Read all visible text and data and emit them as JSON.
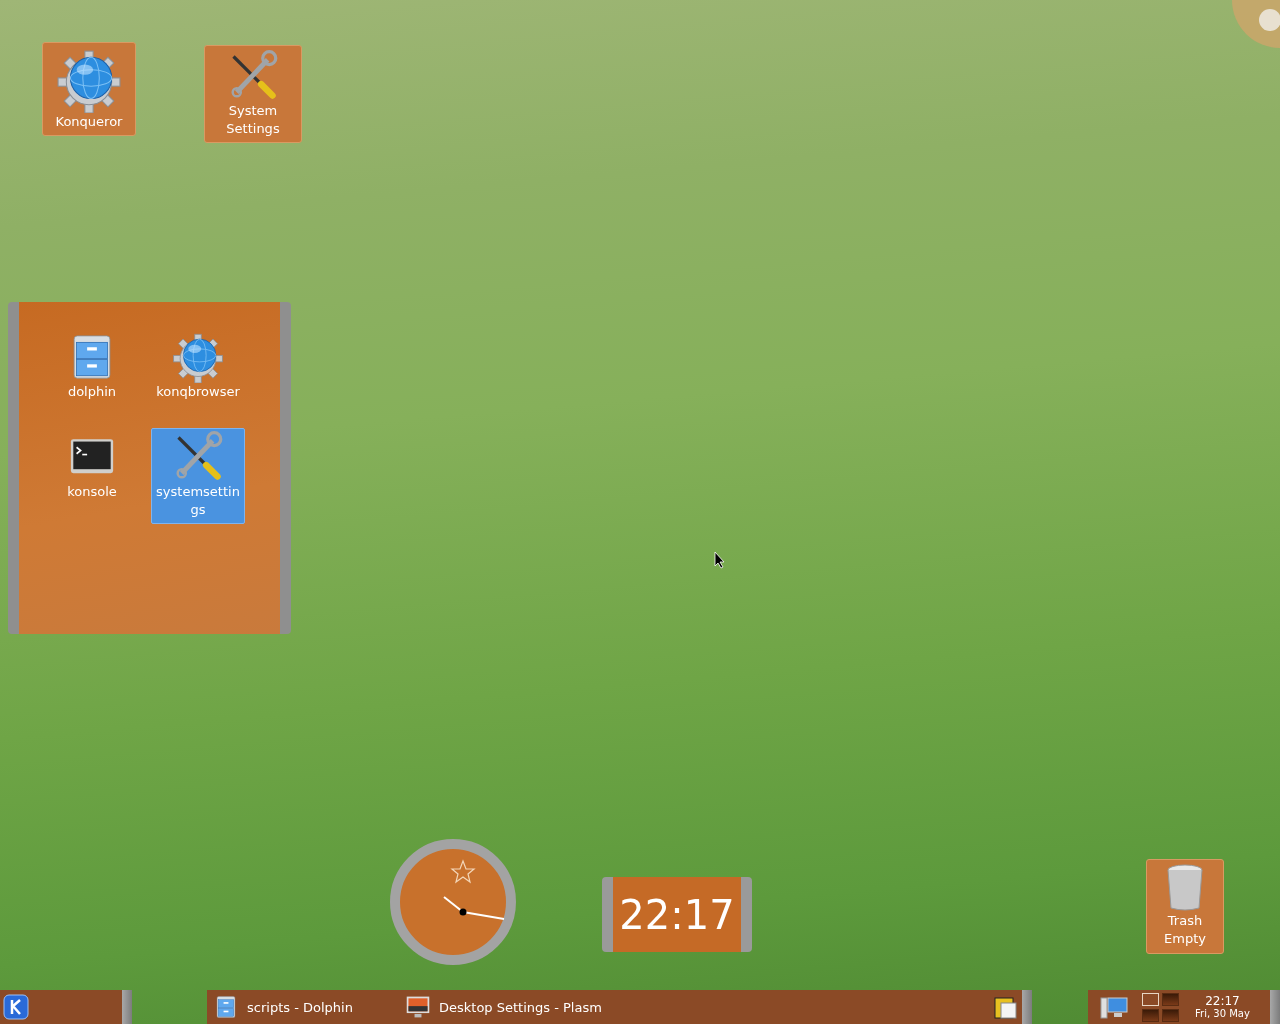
{
  "desktop_icons": [
    {
      "label": "Konqueror",
      "kind": "globe"
    },
    {
      "label": "System Settings",
      "kind": "tools"
    }
  ],
  "folder_view": {
    "items": [
      {
        "label": "dolphin",
        "kind": "drawer",
        "selected": false
      },
      {
        "label": "konqbrowser",
        "kind": "globe",
        "selected": false
      },
      {
        "label": "konsole",
        "kind": "terminal",
        "selected": false
      },
      {
        "label": "systemsettings",
        "kind": "tools",
        "selected": true
      }
    ]
  },
  "digital_clock": {
    "time": "22:17"
  },
  "trash": {
    "label": "Trash",
    "status": "Empty"
  },
  "taskbar": {
    "tasks": [
      {
        "title": "scripts - Dolphin",
        "kind": "drawer"
      },
      {
        "title": "Desktop Settings - Plasm",
        "kind": "display"
      }
    ],
    "pager": [
      {
        "selected": true
      },
      {
        "selected": false
      },
      {
        "selected": false
      },
      {
        "selected": false
      }
    ],
    "clock": {
      "time": "22:17",
      "date": "Fri, 30 May"
    }
  }
}
